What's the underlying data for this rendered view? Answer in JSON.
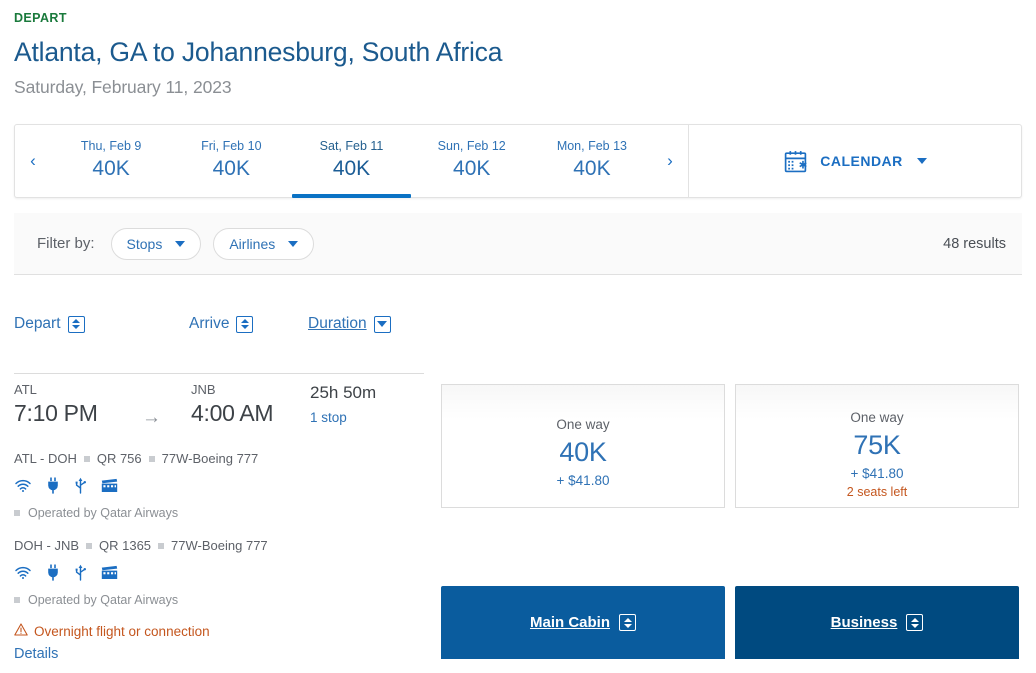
{
  "header": {
    "depart_label": "DEPART",
    "route_title": "Atlanta, GA to Johannesburg, South Africa",
    "route_date": "Saturday, February 11, 2023"
  },
  "date_strip": {
    "prev_icon": "‹",
    "next_icon": "›",
    "days": [
      {
        "name": "Thu, Feb 9",
        "value": "40K",
        "active": false
      },
      {
        "name": "Fri, Feb 10",
        "value": "40K",
        "active": false
      },
      {
        "name": "Sat, Feb 11",
        "value": "40K",
        "active": true
      },
      {
        "name": "Sun, Feb 12",
        "value": "40K",
        "active": false
      },
      {
        "name": "Mon, Feb 13",
        "value": "40K",
        "active": false
      }
    ],
    "calendar_label": "CALENDAR"
  },
  "filter_bar": {
    "label": "Filter by:",
    "filters": [
      {
        "label": "Stops"
      },
      {
        "label": "Airlines"
      }
    ],
    "results": "48 results"
  },
  "sort": {
    "depart": "Depart",
    "arrive": "Arrive",
    "duration": "Duration"
  },
  "cabins": [
    {
      "label": "Main Cabin",
      "color": "#0a5c9e"
    },
    {
      "label": "Business",
      "color": "#004a80"
    }
  ],
  "flight": {
    "depart_code": "ATL",
    "depart_time": "7:10 PM",
    "arrive_code": "JNB",
    "arrive_time": "4:00 AM",
    "duration": "25h 50m",
    "stops": "1 stop",
    "segments": [
      {
        "route": "ATL - DOH",
        "flight_number": "QR 756",
        "aircraft": "77W-Boeing 777",
        "operated_by": "Operated by Qatar Airways",
        "amenities": [
          "wifi-icon",
          "power-outlet-icon",
          "usb-icon",
          "entertainment-icon"
        ]
      },
      {
        "route": "DOH - JNB",
        "flight_number": "QR 1365",
        "aircraft": "77W-Boeing 777",
        "operated_by": "Operated by Qatar Airways",
        "amenities": [
          "wifi-icon",
          "power-outlet-icon",
          "usb-icon",
          "entertainment-icon"
        ]
      }
    ],
    "warning": "Overnight flight or connection",
    "details_link": "Details"
  },
  "fares": [
    {
      "cabin": "Main Cabin",
      "one_way": "One way",
      "miles": "40K",
      "taxes": "+ $41.80",
      "seats_left": ""
    },
    {
      "cabin": "Business",
      "one_way": "One way",
      "miles": "75K",
      "taxes": "+ $41.80",
      "seats_left": "2 seats left"
    }
  ]
}
